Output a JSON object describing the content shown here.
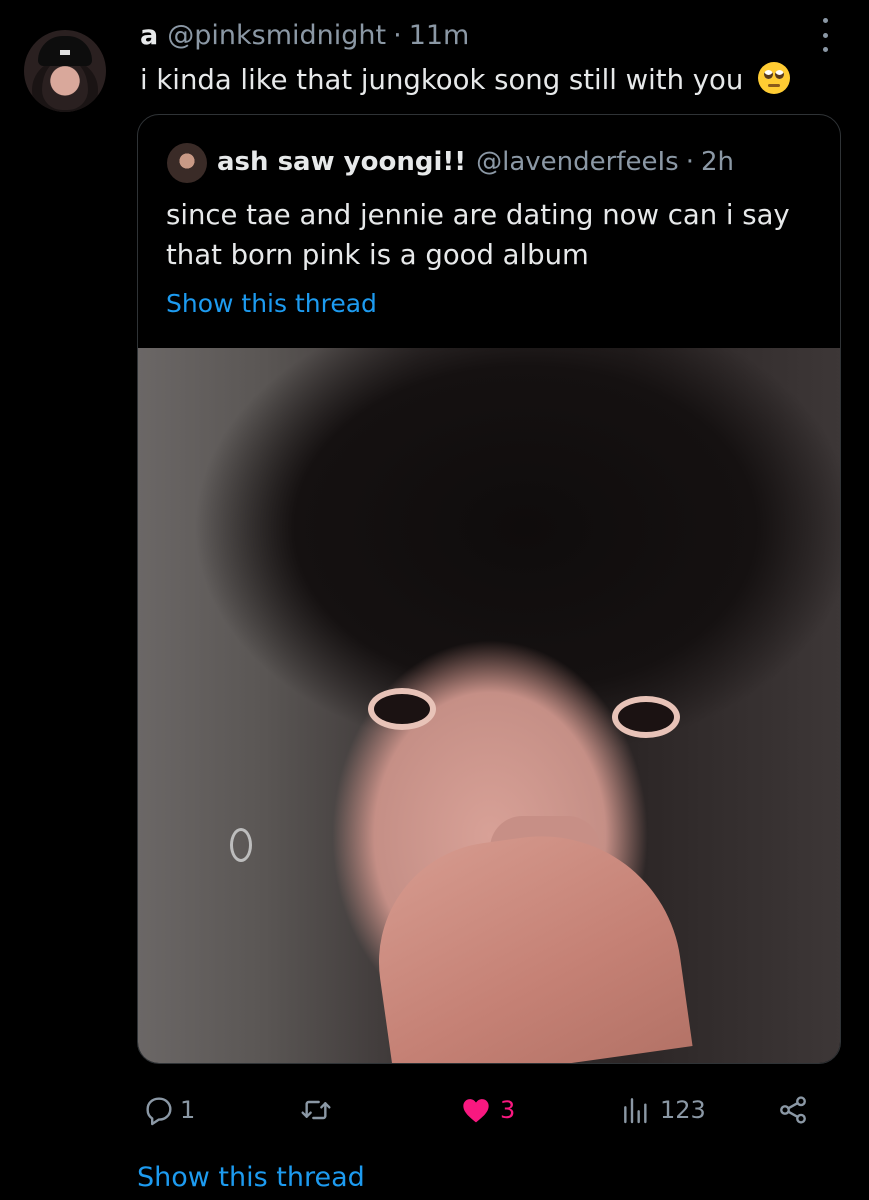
{
  "tweet": {
    "display_name": "a",
    "handle": "@pinksmidnight",
    "separator": "·",
    "time": "11m",
    "text": "i kinda like that jungkook song still with you",
    "emoji_icon": "face-with-rolling-eyes-emoji"
  },
  "quote": {
    "display_name": "ash saw yoongi!!",
    "handle": "@lavenderfeeIs",
    "separator": "·",
    "time": "2h",
    "text": "since tae and jennie are dating now can i say that born pink is a good album",
    "show_thread": "Show this thread"
  },
  "actions": {
    "reply_count": "1",
    "retweet_count": "",
    "like_count": "3",
    "views_count": "123",
    "liked": true,
    "colors": {
      "muted": "#8b98a5",
      "like": "#f91880",
      "link": "#1d9bf0"
    }
  },
  "footer": {
    "show_thread": "Show this thread"
  }
}
